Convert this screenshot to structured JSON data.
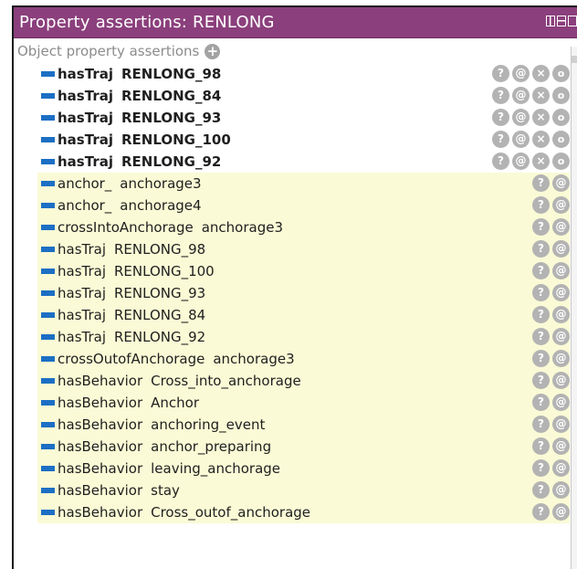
{
  "panel": {
    "title": "Property assertions: RENLONG"
  },
  "section": {
    "label": "Object property assertions"
  },
  "icons": {
    "add": "add-icon",
    "explain": "?",
    "annotate": "@",
    "delete": "×",
    "edit": "o"
  },
  "asserted": [
    {
      "property": "hasTraj",
      "value": "RENLONG_98"
    },
    {
      "property": "hasTraj",
      "value": "RENLONG_84"
    },
    {
      "property": "hasTraj",
      "value": "RENLONG_93"
    },
    {
      "property": "hasTraj",
      "value": "RENLONG_100"
    },
    {
      "property": "hasTraj",
      "value": "RENLONG_92"
    }
  ],
  "inferred": [
    {
      "property": "anchor_",
      "value": "anchorage3"
    },
    {
      "property": "anchor_",
      "value": "anchorage4"
    },
    {
      "property": "crossIntoAnchorage",
      "value": "anchorage3"
    },
    {
      "property": "hasTraj",
      "value": "RENLONG_98"
    },
    {
      "property": "hasTraj",
      "value": "RENLONG_100"
    },
    {
      "property": "hasTraj",
      "value": "RENLONG_93"
    },
    {
      "property": "hasTraj",
      "value": "RENLONG_84"
    },
    {
      "property": "hasTraj",
      "value": "RENLONG_92"
    },
    {
      "property": "crossOutofAnchorage",
      "value": "anchorage3"
    },
    {
      "property": "hasBehavior",
      "value": "Cross_into_anchorage"
    },
    {
      "property": "hasBehavior",
      "value": "Anchor"
    },
    {
      "property": "hasBehavior",
      "value": "anchoring_event"
    },
    {
      "property": "hasBehavior",
      "value": "anchor_preparing"
    },
    {
      "property": "hasBehavior",
      "value": "leaving_anchorage"
    },
    {
      "property": "hasBehavior",
      "value": "stay"
    },
    {
      "property": "hasBehavior",
      "value": "Cross_outof_anchorage"
    }
  ],
  "colors": {
    "titlebar": "#8b3f7c",
    "inferred_bg": "#fafad6",
    "property_icon": "#1c6fc4"
  }
}
